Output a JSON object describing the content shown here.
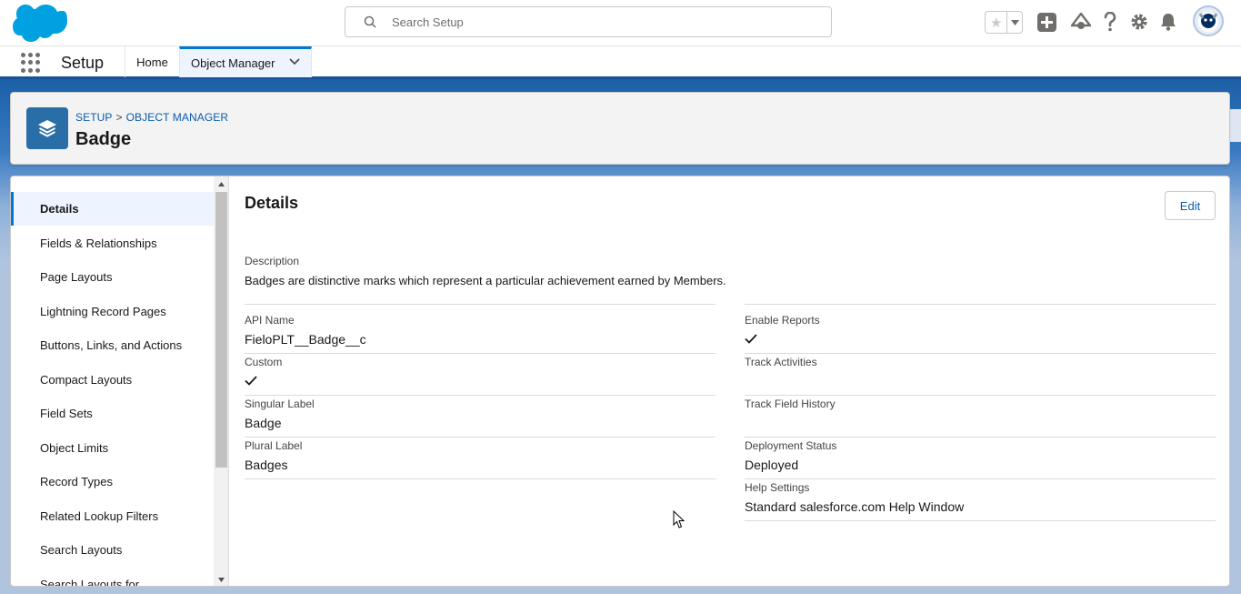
{
  "header": {
    "search_placeholder": "Search Setup",
    "brand_color": "#0176d3"
  },
  "app_nav": {
    "app_name": "Setup",
    "tabs": [
      {
        "label": "Home"
      },
      {
        "label": "Object Manager"
      }
    ]
  },
  "object_header": {
    "breadcrumb": [
      "SETUP",
      "OBJECT MANAGER"
    ],
    "breadcrumb_separator": ">",
    "title": "Badge"
  },
  "sidebar": {
    "items": [
      {
        "label": "Details",
        "active": true
      },
      {
        "label": "Fields & Relationships"
      },
      {
        "label": "Page Layouts"
      },
      {
        "label": "Lightning Record Pages"
      },
      {
        "label": "Buttons, Links, and Actions"
      },
      {
        "label": "Compact Layouts"
      },
      {
        "label": "Field Sets"
      },
      {
        "label": "Object Limits"
      },
      {
        "label": "Record Types"
      },
      {
        "label": "Related Lookup Filters"
      },
      {
        "label": "Search Layouts"
      },
      {
        "label": "Search Layouts for"
      }
    ]
  },
  "details": {
    "title": "Details",
    "edit_label": "Edit",
    "description_label": "Description",
    "description_value": "Badges are distinctive marks which represent a particular achievement earned by Members.",
    "left_fields": [
      {
        "label": "API Name",
        "value": "FieloPLT__Badge__c"
      },
      {
        "label": "Custom",
        "value": "",
        "checked": true
      },
      {
        "label": "Singular Label",
        "value": "Badge"
      },
      {
        "label": "Plural Label",
        "value": "Badges"
      }
    ],
    "right_fields": [
      {
        "label": "Enable Reports",
        "value": "",
        "checked": true
      },
      {
        "label": "Track Activities",
        "value": ""
      },
      {
        "label": "Track Field History",
        "value": ""
      },
      {
        "label": "Deployment Status",
        "value": "Deployed"
      },
      {
        "label": "Help Settings",
        "value": "Standard salesforce.com Help Window"
      }
    ]
  }
}
